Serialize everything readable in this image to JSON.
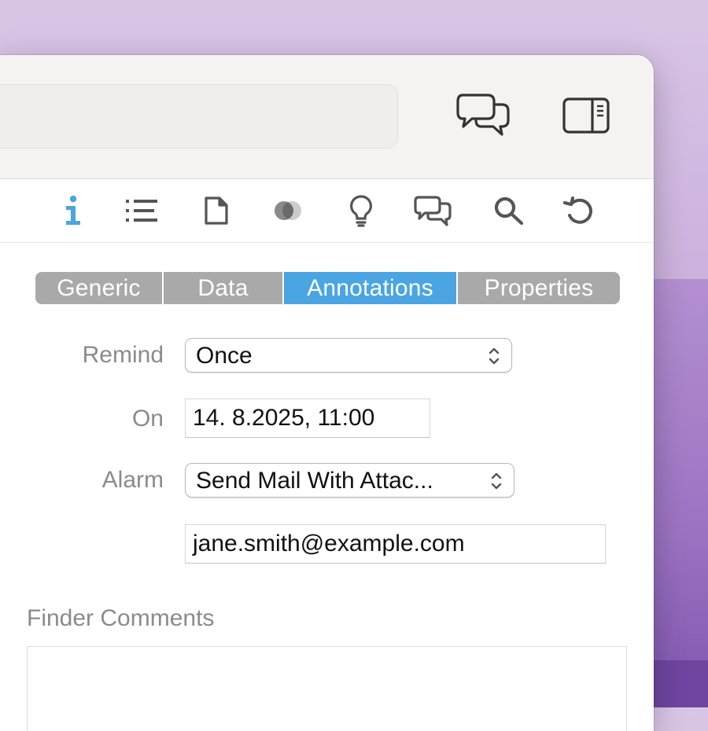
{
  "toolbar": {
    "chat_icon": "speech-bubbles-icon",
    "sidebar_icon": "sidebar-toggle-icon"
  },
  "inspector": {
    "active_color": "#4aa5e2",
    "icons": [
      "info-icon",
      "list-icon",
      "document-icon",
      "overlap-circles-icon",
      "lightbulb-icon",
      "chat-bubbles-icon",
      "search-icon",
      "history-icon"
    ]
  },
  "tabs": [
    {
      "label": "Generic",
      "active": false
    },
    {
      "label": "Data",
      "active": false
    },
    {
      "label": "Annotations",
      "active": true
    },
    {
      "label": "Properties",
      "active": false
    }
  ],
  "form": {
    "remind_label": "Remind",
    "remind_value": "Once",
    "on_label": "On",
    "on_value": "14.  8.2025, 11:00",
    "alarm_label": "Alarm",
    "alarm_value": "Send Mail With Attac...",
    "email_value": "jane.smith@example.com"
  },
  "comments": {
    "label": "Finder Comments",
    "value": ""
  }
}
